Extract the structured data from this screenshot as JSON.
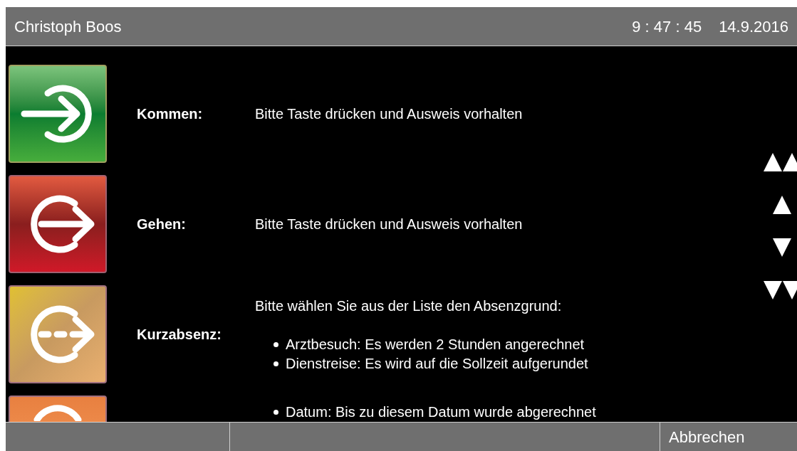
{
  "header": {
    "user": "Christoph Boos",
    "time": "9 : 47 : 45",
    "date": "14.9.2016"
  },
  "actions": [
    {
      "kind": "come",
      "label": "Kommen:",
      "description": "Bitte Taste drücken und Ausweis vorhalten"
    },
    {
      "kind": "go",
      "label": "Gehen:",
      "description": "Bitte Taste drücken und Ausweis vorhalten"
    },
    {
      "kind": "short",
      "label": "Kurzabsenz:",
      "description": "Bitte wählen Sie aus der Liste den Absenzgrund:",
      "bullets": [
        "Arztbesuch: Es werden 2 Stunden angerechnet",
        "Dienstreise: Es wird auf die Sollzeit aufgerundet"
      ]
    },
    {
      "kind": "other",
      "bullets": [
        "Datum: Bis zu diesem Datum wurde abgerechnet"
      ]
    }
  ],
  "scroll_buttons": [
    {
      "kind": "page-up"
    },
    {
      "kind": "up"
    },
    {
      "kind": "down"
    },
    {
      "kind": "page-down"
    }
  ],
  "footer": {
    "cancel": "Abbrechen"
  }
}
